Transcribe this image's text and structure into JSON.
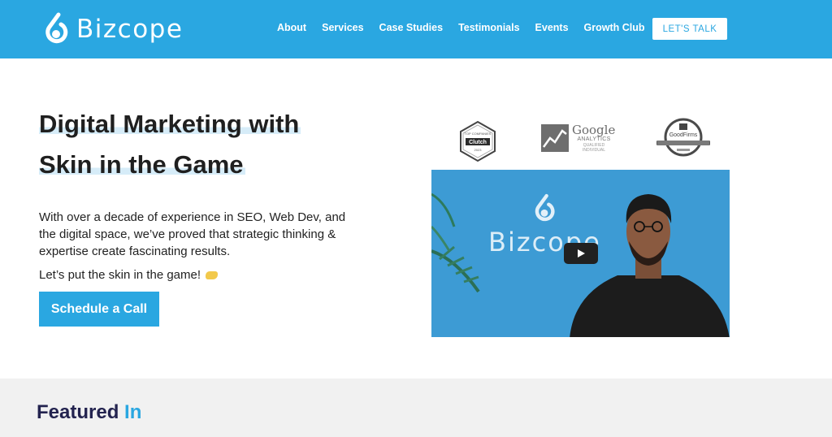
{
  "header": {
    "brand": "Bizcope",
    "nav": [
      "About",
      "Services",
      "Case Studies",
      "Testimonials",
      "Events",
      "Growth Club"
    ],
    "cta_label": "LET'S TALK"
  },
  "hero": {
    "headline_line1": "Digital Marketing with",
    "headline_line2": "Skin in the Game",
    "paragraph": "With over a decade of experience in SEO, Web Dev, and the digital space, we’ve proved that strategic thinking & expertise create fascinating results.",
    "tagline": "Let’s put the skin in the game!",
    "cta_label": "Schedule a Call"
  },
  "badges": {
    "clutch_top": "TOP COMPANIES",
    "clutch_name": "Clutch",
    "clutch_year": "2023",
    "google_word": "Google",
    "google_sub": "ANALYTICS",
    "google_sub2": "QUALIFIED INDIVIDUAL",
    "good_name": "GoodFirms"
  },
  "video": {
    "logo_word": "Bizcope"
  },
  "featured": {
    "title_main": "Featured",
    "title_accent": "In"
  },
  "colors": {
    "brand": "#2aa7e1",
    "dark_heading": "#23234f",
    "highlight": "#d6ecf8"
  },
  "icons": [
    "bizcope-logo-icon",
    "play-icon",
    "clutch-badge-icon",
    "google-analytics-icon",
    "goodfirms-badge-icon",
    "handshake-emoji-icon"
  ]
}
